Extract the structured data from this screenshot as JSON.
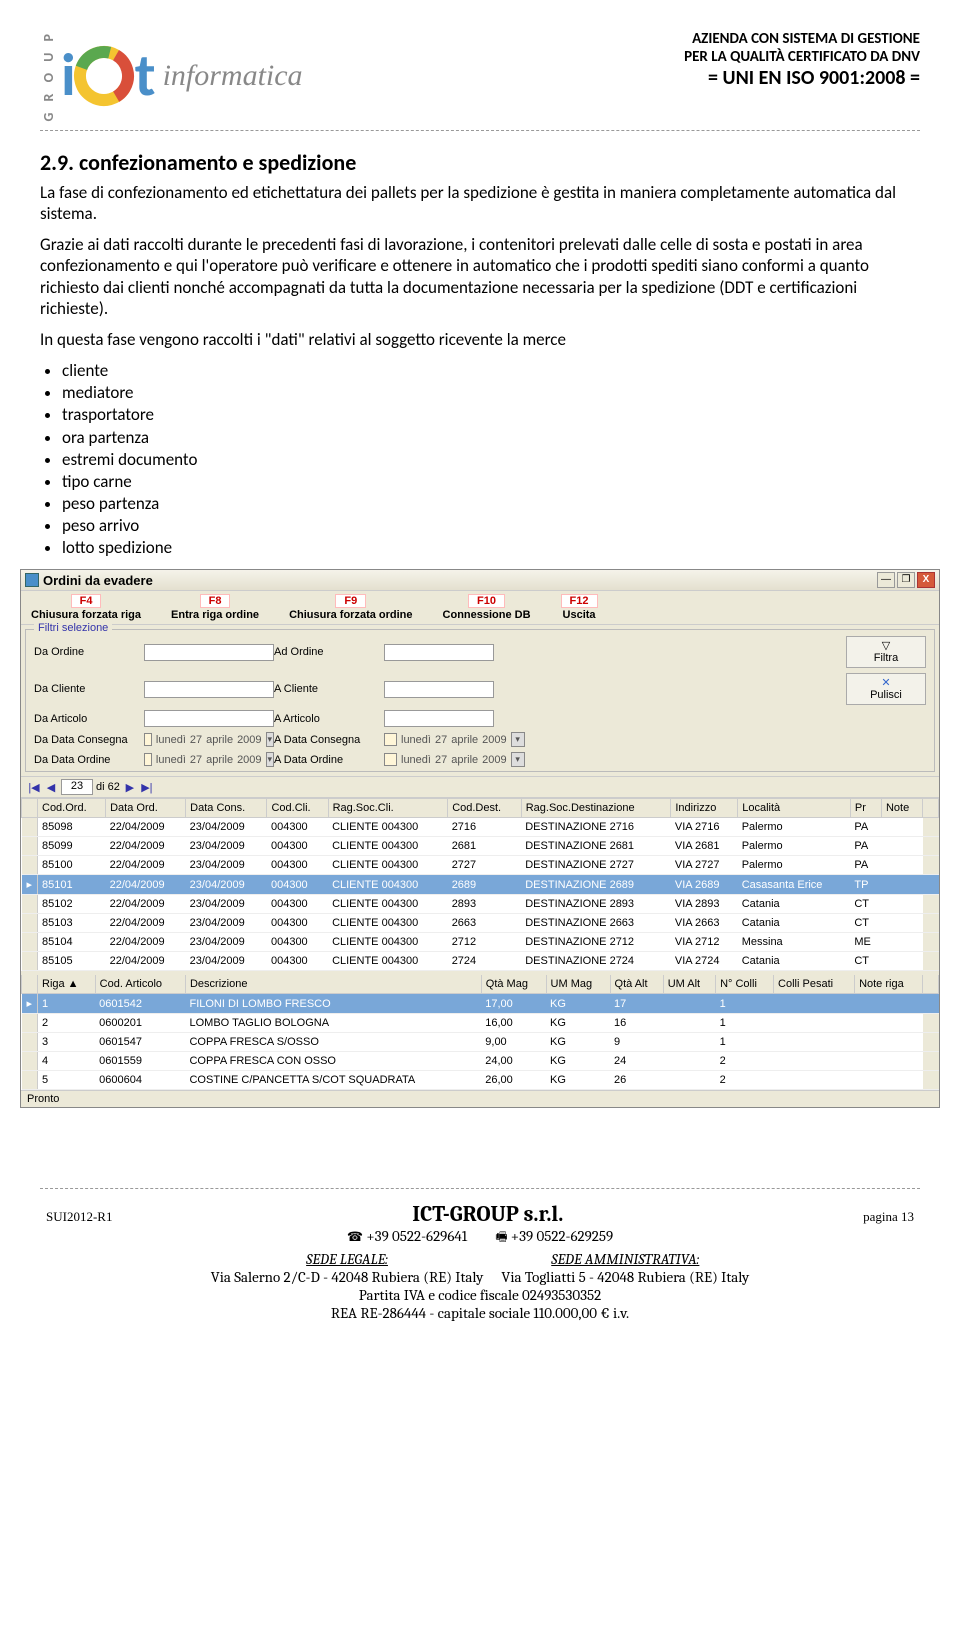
{
  "header": {
    "group_text": "G R O U P",
    "logo_informatica": "informatica",
    "cert_line1": "AZIENDA CON SISTEMA DI GESTIONE",
    "cert_line2": "PER LA QUALITÀ CERTIFICATO DA DNV",
    "cert_line3": "= UNI EN ISO 9001:2008 ="
  },
  "doc": {
    "section_heading": "2.9. confezionamento e spedizione",
    "p1": "La fase di confezionamento ed etichettatura dei pallets per la spedizione è gestita in maniera completamente automatica dal sistema.",
    "p2": "Grazie ai dati raccolti durante le precedenti fasi di lavorazione, i contenitori prelevati dalle celle di sosta e postati in area confezionamento e qui l'operatore può verificare e ottenere in automatico che i prodotti spediti siano conformi a quanto richiesto dai clienti nonché accompagnati da tutta la documentazione necessaria per la spedizione (DDT e certificazioni richieste).",
    "p3": "In questa fase vengono raccolti i \"dati\" relativi al soggetto ricevente la merce",
    "bullets": [
      "cliente",
      "mediatore",
      "trasportatore",
      "ora partenza",
      "estremi documento",
      "tipo carne",
      "peso partenza",
      "peso arrivo",
      "lotto spedizione"
    ]
  },
  "app": {
    "title": "Ordini da evadere",
    "toolbar": [
      {
        "key": "F4",
        "label": "Chiusura forzata riga"
      },
      {
        "key": "F8",
        "label": "Entra riga ordine"
      },
      {
        "key": "F9",
        "label": "Chiusura forzata ordine"
      },
      {
        "key": "F10",
        "label": "Connessione DB"
      },
      {
        "key": "F12",
        "label": "Uscita"
      }
    ],
    "filters": {
      "legend": "Filtri selezione",
      "da_ordine": "Da Ordine",
      "ad_ordine": "Ad Ordine",
      "da_cliente": "Da Cliente",
      "a_cliente": "A Cliente",
      "da_articolo": "Da Articolo",
      "a_articolo": "A Articolo",
      "da_data_consegna": "Da Data Consegna",
      "a_data_consegna": "A Data Consegna",
      "da_data_ordine": "Da Data Ordine",
      "a_data_ordine": "A Data Ordine",
      "date_display": {
        "dow": "lunedì",
        "day": "27",
        "month": "aprile",
        "year": "2009"
      },
      "btn_filtra": "Filtra",
      "btn_pulisci": "Pulisci"
    },
    "pager": {
      "current": "23",
      "total": "di 62"
    },
    "grid1": {
      "columns": [
        "Cod.Ord.",
        "Data Ord.",
        "Data Cons.",
        "Cod.Cli.",
        "Rag.Soc.Cli.",
        "Cod.Dest.",
        "Rag.Soc.Destinazione",
        "Indirizzo",
        "Località",
        "Pr",
        "Note"
      ],
      "rows": [
        [
          "85098",
          "22/04/2009",
          "23/04/2009",
          "004300",
          "CLIENTE 004300",
          "2716",
          "DESTINAZIONE 2716",
          "VIA 2716",
          "Palermo",
          "PA",
          ""
        ],
        [
          "85099",
          "22/04/2009",
          "23/04/2009",
          "004300",
          "CLIENTE 004300",
          "2681",
          "DESTINAZIONE 2681",
          "VIA 2681",
          "Palermo",
          "PA",
          ""
        ],
        [
          "85100",
          "22/04/2009",
          "23/04/2009",
          "004300",
          "CLIENTE 004300",
          "2727",
          "DESTINAZIONE 2727",
          "VIA 2727",
          "Palermo",
          "PA",
          ""
        ],
        [
          "85101",
          "22/04/2009",
          "23/04/2009",
          "004300",
          "CLIENTE 004300",
          "2689",
          "DESTINAZIONE 2689",
          "VIA 2689",
          "Casasanta Erice",
          "TP",
          ""
        ],
        [
          "85102",
          "22/04/2009",
          "23/04/2009",
          "004300",
          "CLIENTE 004300",
          "2893",
          "DESTINAZIONE 2893",
          "VIA 2893",
          "Catania",
          "CT",
          ""
        ],
        [
          "85103",
          "22/04/2009",
          "23/04/2009",
          "004300",
          "CLIENTE 004300",
          "2663",
          "DESTINAZIONE 2663",
          "VIA 2663",
          "Catania",
          "CT",
          ""
        ],
        [
          "85104",
          "22/04/2009",
          "23/04/2009",
          "004300",
          "CLIENTE 004300",
          "2712",
          "DESTINAZIONE 2712",
          "VIA 2712",
          "Messina",
          "ME",
          ""
        ],
        [
          "85105",
          "22/04/2009",
          "23/04/2009",
          "004300",
          "CLIENTE 004300",
          "2724",
          "DESTINAZIONE 2724",
          "VIA 2724",
          "Catania",
          "CT",
          ""
        ]
      ],
      "selected_index": 3
    },
    "grid2": {
      "columns": [
        "Riga ▲",
        "Cod. Articolo",
        "Descrizione",
        "Qtà Mag",
        "UM Mag",
        "Qtà Alt",
        "UM Alt",
        "N° Colli",
        "Colli Pesati",
        "Note riga"
      ],
      "rows": [
        [
          "1",
          "0601542",
          "FILONI DI LOMBO FRESCO",
          "17,00",
          "KG",
          "17",
          "",
          "1",
          "",
          ""
        ],
        [
          "2",
          "0600201",
          "LOMBO TAGLIO BOLOGNA",
          "16,00",
          "KG",
          "16",
          "",
          "1",
          "",
          ""
        ],
        [
          "3",
          "0601547",
          "COPPA FRESCA S/OSSO",
          "9,00",
          "KG",
          "9",
          "",
          "1",
          "",
          ""
        ],
        [
          "4",
          "0601559",
          "COPPA FRESCA CON OSSO",
          "24,00",
          "KG",
          "24",
          "",
          "2",
          "",
          ""
        ],
        [
          "5",
          "0600604",
          "COSTINE C/PANCETTA S/COT SQUADRATA",
          "26,00",
          "KG",
          "26",
          "",
          "2",
          "",
          ""
        ]
      ],
      "selected_index": 0
    },
    "status": "Pronto"
  },
  "footer": {
    "left_code": "SUI2012-R1",
    "company": "ICT-GROUP s.r.l.",
    "page_label": "pagina 13",
    "phone1": "+39 0522-629641",
    "phone2": "+39 0522-629259",
    "sede_legale_label": "SEDE LEGALE:",
    "sede_legale_addr": "Via Salerno 2/C-D - 42048 Rubiera (RE) Italy",
    "sede_amm_label": "SEDE AMMINISTRATIVA:",
    "sede_amm_addr": "Via Togliatti 5 - 42048 Rubiera (RE) Italy",
    "piva": "Partita IVA e codice fiscale 02493530352",
    "rea": "REA  RE-286444  -  capitale sociale 110.000,00 € i.v."
  }
}
